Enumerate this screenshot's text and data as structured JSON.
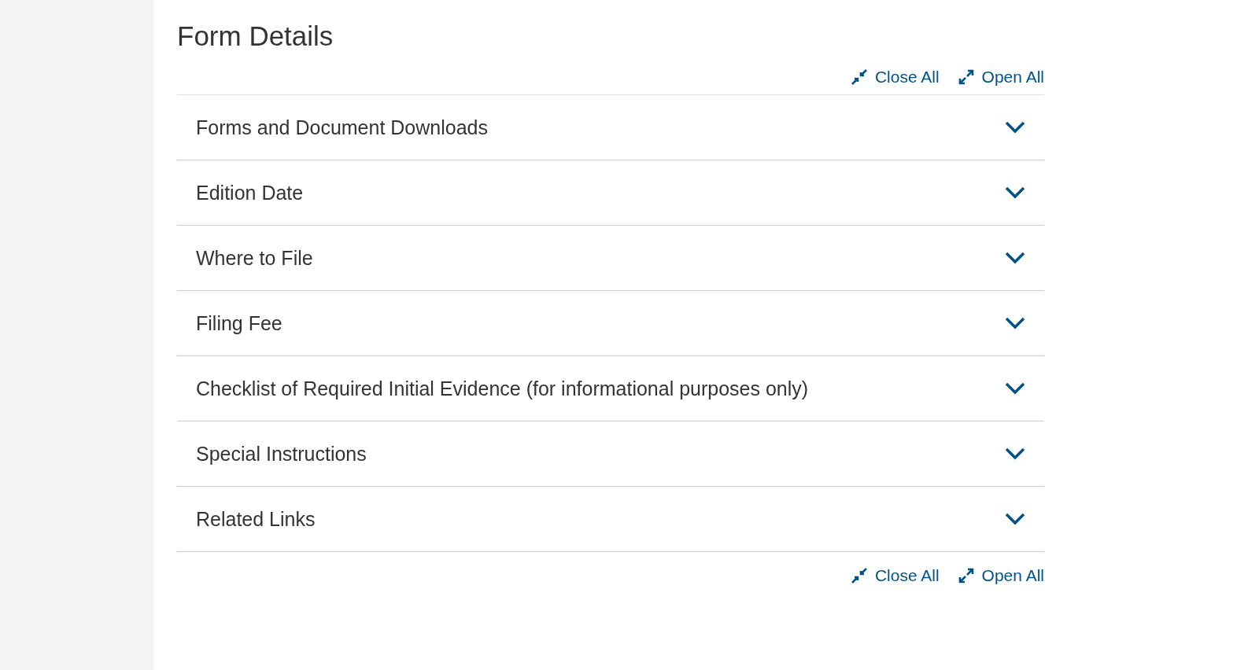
{
  "page": {
    "title": "Form Details"
  },
  "controls_top": [
    {
      "kind": "close",
      "label": "Close All"
    },
    {
      "kind": "open",
      "label": "Open All"
    }
  ],
  "accordion": [
    {
      "title": "Forms and Document Downloads",
      "expanded": false
    },
    {
      "title": "Edition Date",
      "expanded": false
    },
    {
      "title": "Where to File",
      "expanded": false
    },
    {
      "title": "Filing Fee",
      "expanded": false
    },
    {
      "title": "Checklist of Required Initial Evidence (for informational purposes only)",
      "expanded": false
    },
    {
      "title": "Special Instructions",
      "expanded": false
    },
    {
      "title": "Related Links",
      "expanded": false
    }
  ],
  "controls_bottom": [
    {
      "kind": "close",
      "label": "Close All"
    },
    {
      "kind": "open",
      "label": "Open All"
    }
  ]
}
